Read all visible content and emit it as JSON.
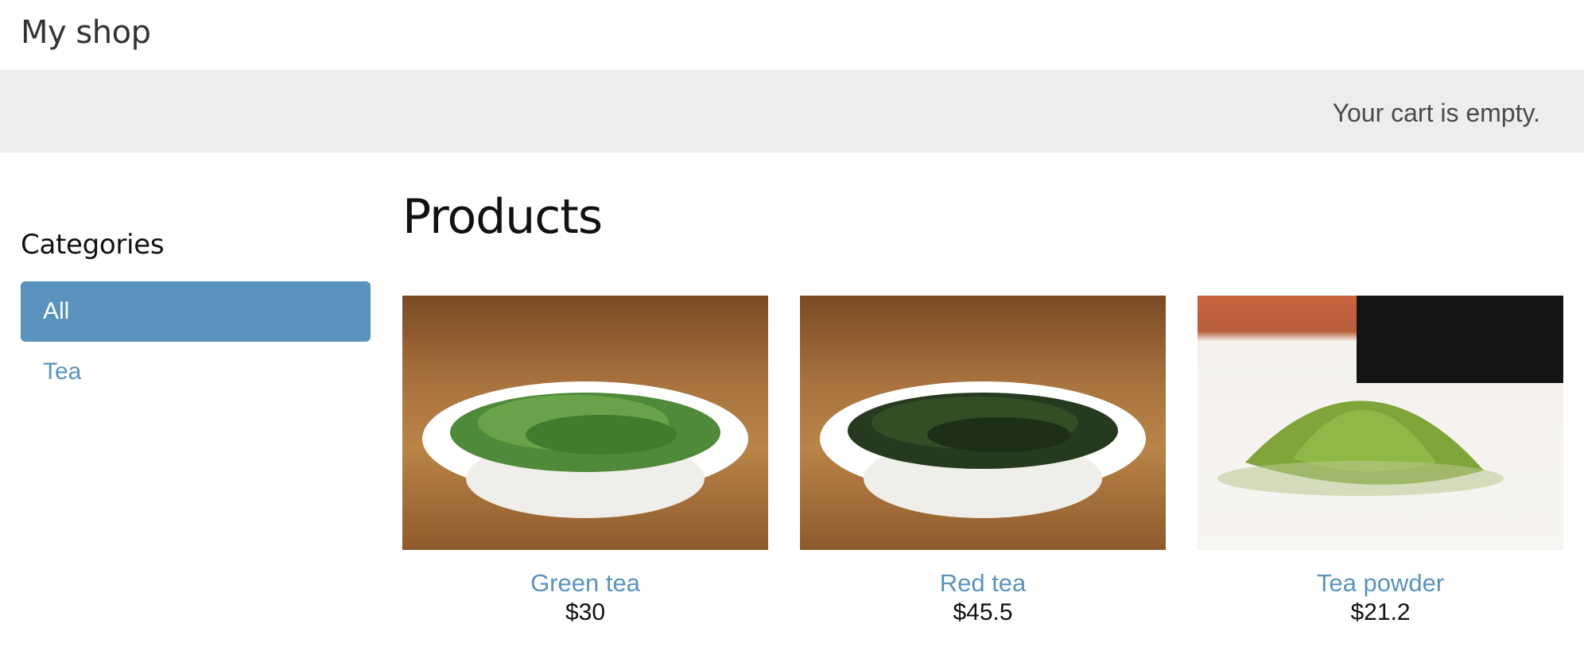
{
  "header": {
    "title": "My shop"
  },
  "cart": {
    "status": "Your cart is empty."
  },
  "sidebar": {
    "heading": "Categories",
    "items": [
      {
        "label": "All",
        "active": true
      },
      {
        "label": "Tea",
        "active": false
      }
    ]
  },
  "main": {
    "title": "Products",
    "products": [
      {
        "name": "Green tea",
        "price": "$30",
        "image": "green-tea-bowl-image"
      },
      {
        "name": "Red tea",
        "price": "$45.5",
        "image": "red-tea-bowl-image"
      },
      {
        "name": "Tea powder",
        "price": "$21.2",
        "image": "tea-powder-pile-image"
      }
    ]
  },
  "colors": {
    "accent": "#5993bd",
    "subheader_bg": "#ededed",
    "text": "#111111"
  }
}
